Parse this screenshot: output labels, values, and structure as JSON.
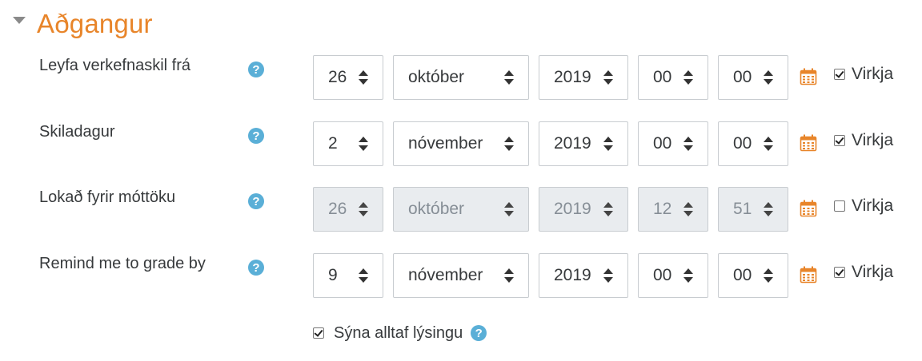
{
  "section": {
    "title": "Aðgangur"
  },
  "rows": [
    {
      "label": "Leyfa verkefnaskil frá",
      "day": "26",
      "month": "október",
      "year": "2019",
      "hour": "00",
      "minute": "00",
      "enabled": true,
      "enable_label": "Virkja"
    },
    {
      "label": "Skiladagur",
      "day": "2",
      "month": "nóvember",
      "year": "2019",
      "hour": "00",
      "minute": "00",
      "enabled": true,
      "enable_label": "Virkja"
    },
    {
      "label": "Lokað fyrir móttöku",
      "day": "26",
      "month": "október",
      "year": "2019",
      "hour": "12",
      "minute": "51",
      "enabled": false,
      "enable_label": "Virkja"
    },
    {
      "label": "Remind me to grade by",
      "day": "9",
      "month": "nóvember",
      "year": "2019",
      "hour": "00",
      "minute": "00",
      "enabled": true,
      "enable_label": "Virkja"
    }
  ],
  "always_show_description": {
    "label": "Sýna alltaf lýsingu",
    "checked": true
  },
  "colors": {
    "accent": "#e8852a",
    "help": "#5aafd7",
    "calendar": "#e8852a",
    "disabled_bg": "#e9ecef"
  },
  "icons": {
    "help": "question-circle-icon",
    "calendar": "calendar-icon",
    "section_toggle": "caret-down-icon"
  }
}
